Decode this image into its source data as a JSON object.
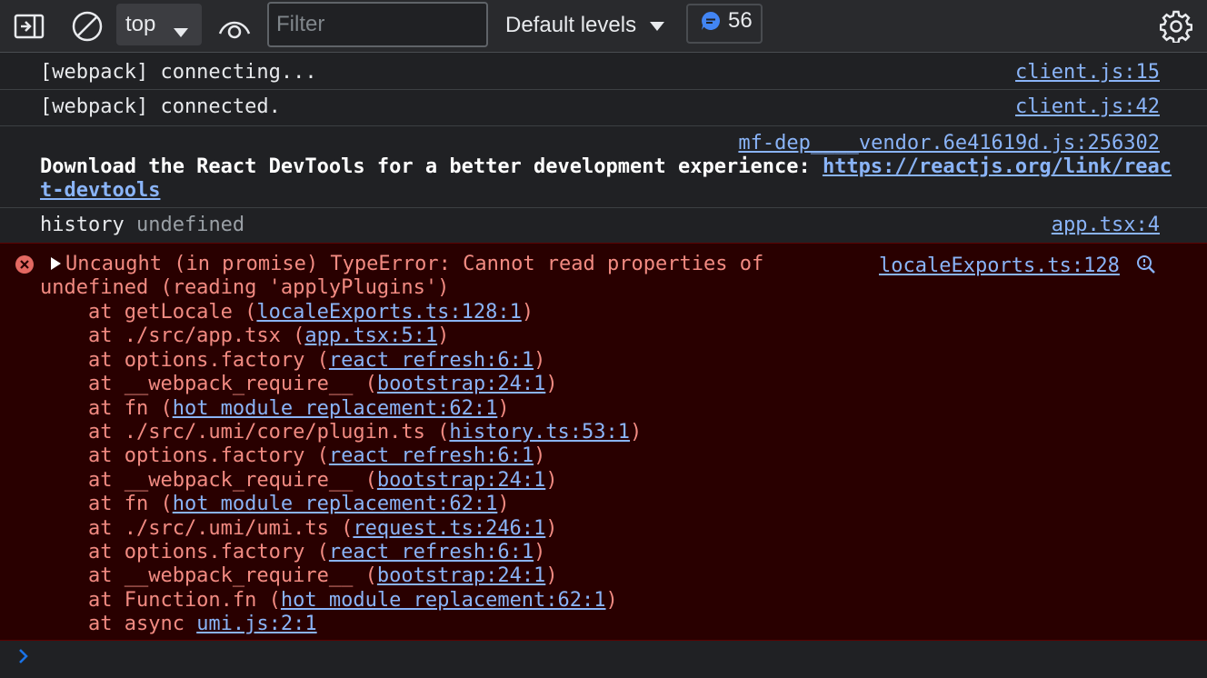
{
  "toolbar": {
    "context": "top",
    "filter_placeholder": "Filter",
    "levels_label": "Default levels",
    "message_count": "56"
  },
  "colors": {
    "background": "#202124",
    "toolbar": "#292a2d",
    "error_bg": "#290000",
    "error_text": "#f28b82",
    "link": "#8ab4f8"
  },
  "logs": [
    {
      "text": "[webpack] connecting...",
      "source": "client.js:15"
    },
    {
      "text": "[webpack] connected.",
      "source": "client.js:42"
    },
    {
      "source": "mf-dep____vendor.6e41619d.js:256302",
      "text": "Download the React DevTools for a better development experience: ",
      "link_part1": "https://reactjs.org/link/reac",
      "link_part2": "t-devtools"
    },
    {
      "text": "history",
      "value": "undefined",
      "source": "app.tsx:4"
    }
  ],
  "error": {
    "line1": "Uncaught (in promise) TypeError: Cannot read properties of",
    "line2": "undefined (reading 'applyPlugins')",
    "source": "localeExports.ts:128",
    "stack": [
      {
        "pre": "    at getLocale (",
        "link": "localeExports.ts:128:1",
        "post": ")"
      },
      {
        "pre": "    at ./src/app.tsx (",
        "link": "app.tsx:5:1",
        "post": ")"
      },
      {
        "pre": "    at options.factory (",
        "link": "react refresh:6:1",
        "post": ")"
      },
      {
        "pre": "    at __webpack_require__ (",
        "link": "bootstrap:24:1",
        "post": ")"
      },
      {
        "pre": "    at fn (",
        "link": "hot module replacement:62:1",
        "post": ")"
      },
      {
        "pre": "    at ./src/.umi/core/plugin.ts (",
        "link": "history.ts:53:1",
        "post": ")"
      },
      {
        "pre": "    at options.factory (",
        "link": "react refresh:6:1",
        "post": ")"
      },
      {
        "pre": "    at __webpack_require__ (",
        "link": "bootstrap:24:1",
        "post": ")"
      },
      {
        "pre": "    at fn (",
        "link": "hot module replacement:62:1",
        "post": ")"
      },
      {
        "pre": "    at ./src/.umi/umi.ts (",
        "link": "request.ts:246:1",
        "post": ")"
      },
      {
        "pre": "    at options.factory (",
        "link": "react refresh:6:1",
        "post": ")"
      },
      {
        "pre": "    at __webpack_require__ (",
        "link": "bootstrap:24:1",
        "post": ")"
      },
      {
        "pre": "    at Function.fn (",
        "link": "hot module replacement:62:1",
        "post": ")"
      },
      {
        "pre": "    at async ",
        "link": "umi.js:2:1",
        "post": ""
      }
    ]
  }
}
